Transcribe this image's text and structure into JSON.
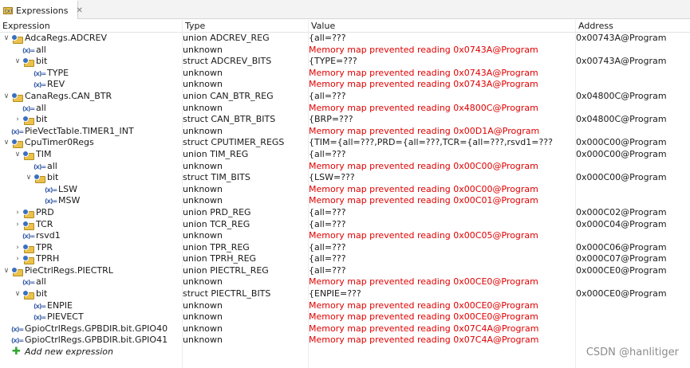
{
  "tab": {
    "title": "Expressions",
    "close": "✕"
  },
  "columns": {
    "expression": "Expression",
    "type": "Type",
    "value": "Value",
    "address": "Address"
  },
  "rows": [
    {
      "expr": "AdcaRegs.ADCREV",
      "type": "union ADCREV_REG",
      "value": "{all=???",
      "addr": "0x00743A@Program",
      "indent": 0,
      "twisty": "open",
      "icon": "struct",
      "err": false
    },
    {
      "expr": "all",
      "type": "unknown",
      "value": "Memory map prevented reading 0x0743A@Program",
      "addr": "",
      "indent": 1,
      "twisty": "none",
      "icon": "var",
      "err": true
    },
    {
      "expr": "bit",
      "type": "struct ADCREV_BITS",
      "value": "{TYPE=???",
      "addr": "0x00743A@Program",
      "indent": 1,
      "twisty": "open",
      "icon": "struct",
      "err": false
    },
    {
      "expr": "TYPE",
      "type": "unknown",
      "value": "Memory map prevented reading 0x0743A@Program",
      "addr": "",
      "indent": 2,
      "twisty": "none",
      "icon": "var",
      "err": true
    },
    {
      "expr": "REV",
      "type": "unknown",
      "value": "Memory map prevented reading 0x0743A@Program",
      "addr": "",
      "indent": 2,
      "twisty": "none",
      "icon": "var",
      "err": true
    },
    {
      "expr": "CanaRegs.CAN_BTR",
      "type": "union CAN_BTR_REG",
      "value": "{all=???",
      "addr": "0x04800C@Program",
      "indent": 0,
      "twisty": "open",
      "icon": "struct",
      "err": false
    },
    {
      "expr": "all",
      "type": "unknown",
      "value": "Memory map prevented reading 0x4800C@Program",
      "addr": "",
      "indent": 1,
      "twisty": "none",
      "icon": "var",
      "err": true
    },
    {
      "expr": "bit",
      "type": "struct CAN_BTR_BITS",
      "value": "{BRP=???",
      "addr": "0x04800C@Program",
      "indent": 1,
      "twisty": "closed",
      "icon": "struct",
      "err": false
    },
    {
      "expr": "PieVectTable.TIMER1_INT",
      "type": "unknown",
      "value": "Memory map prevented reading 0x00D1A@Program",
      "addr": "",
      "indent": 0,
      "twisty": "none",
      "icon": "var",
      "err": true
    },
    {
      "expr": "CpuTimer0Regs",
      "type": "struct CPUTIMER_REGS",
      "value": "{TIM={all=???,PRD={all=???,TCR={all=???,rsvd1=???",
      "addr": "0x000C00@Program",
      "indent": 0,
      "twisty": "open",
      "icon": "struct",
      "err": false
    },
    {
      "expr": "TIM",
      "type": "union TIM_REG",
      "value": "{all=???",
      "addr": "0x000C00@Program",
      "indent": 1,
      "twisty": "open",
      "icon": "struct",
      "err": false
    },
    {
      "expr": "all",
      "type": "unknown",
      "value": "Memory map prevented reading 0x00C00@Program",
      "addr": "",
      "indent": 2,
      "twisty": "none",
      "icon": "var",
      "err": true
    },
    {
      "expr": "bit",
      "type": "struct TIM_BITS",
      "value": "{LSW=???",
      "addr": "0x000C00@Program",
      "indent": 2,
      "twisty": "open",
      "icon": "struct",
      "err": false
    },
    {
      "expr": "LSW",
      "type": "unknown",
      "value": "Memory map prevented reading 0x00C00@Program",
      "addr": "",
      "indent": 3,
      "twisty": "none",
      "icon": "var",
      "err": true
    },
    {
      "expr": "MSW",
      "type": "unknown",
      "value": "Memory map prevented reading 0x00C01@Program",
      "addr": "",
      "indent": 3,
      "twisty": "none",
      "icon": "var",
      "err": true
    },
    {
      "expr": "PRD",
      "type": "union PRD_REG",
      "value": "{all=???",
      "addr": "0x000C02@Program",
      "indent": 1,
      "twisty": "closed",
      "icon": "struct",
      "err": false
    },
    {
      "expr": "TCR",
      "type": "union TCR_REG",
      "value": "{all=???",
      "addr": "0x000C04@Program",
      "indent": 1,
      "twisty": "closed",
      "icon": "struct",
      "err": false
    },
    {
      "expr": "rsvd1",
      "type": "unknown",
      "value": "Memory map prevented reading 0x00C05@Program",
      "addr": "",
      "indent": 1,
      "twisty": "none",
      "icon": "var",
      "err": true
    },
    {
      "expr": "TPR",
      "type": "union TPR_REG",
      "value": "{all=???",
      "addr": "0x000C06@Program",
      "indent": 1,
      "twisty": "closed",
      "icon": "struct",
      "err": false
    },
    {
      "expr": "TPRH",
      "type": "union TPRH_REG",
      "value": "{all=???",
      "addr": "0x000C07@Program",
      "indent": 1,
      "twisty": "closed",
      "icon": "struct",
      "err": false
    },
    {
      "expr": "PieCtrlRegs.PIECTRL",
      "type": "union PIECTRL_REG",
      "value": "{all=???",
      "addr": "0x000CE0@Program",
      "indent": 0,
      "twisty": "open",
      "icon": "struct",
      "err": false
    },
    {
      "expr": "all",
      "type": "unknown",
      "value": "Memory map prevented reading 0x00CE0@Program",
      "addr": "",
      "indent": 1,
      "twisty": "none",
      "icon": "var",
      "err": true
    },
    {
      "expr": "bit",
      "type": "struct PIECTRL_BITS",
      "value": "{ENPIE=???",
      "addr": "0x000CE0@Program",
      "indent": 1,
      "twisty": "open",
      "icon": "struct",
      "err": false
    },
    {
      "expr": "ENPIE",
      "type": "unknown",
      "value": "Memory map prevented reading 0x00CE0@Program",
      "addr": "",
      "indent": 2,
      "twisty": "none",
      "icon": "var",
      "err": true
    },
    {
      "expr": "PIEVECT",
      "type": "unknown",
      "value": "Memory map prevented reading 0x00CE0@Program",
      "addr": "",
      "indent": 2,
      "twisty": "none",
      "icon": "var",
      "err": true
    },
    {
      "expr": "GpioCtrlRegs.GPBDIR.bit.GPIO40",
      "type": "unknown",
      "value": "Memory map prevented reading 0x07C4A@Program",
      "addr": "",
      "indent": 0,
      "twisty": "none",
      "icon": "var",
      "err": true
    },
    {
      "expr": "GpioCtrlRegs.GPBDIR.bit.GPIO41",
      "type": "unknown",
      "value": "Memory map prevented reading 0x07C4A@Program",
      "addr": "",
      "indent": 0,
      "twisty": "none",
      "icon": "var",
      "err": true
    }
  ],
  "add_new": "Add new expression",
  "watermark": "CSDN @hanlitiger",
  "icons": {
    "struct": "struct-icon",
    "var": "variable-icon",
    "add": "add-expression-icon"
  },
  "colors": {
    "error": "#e00000",
    "var_icon": "#3a5fa8",
    "add_icon": "#2fa52f"
  }
}
